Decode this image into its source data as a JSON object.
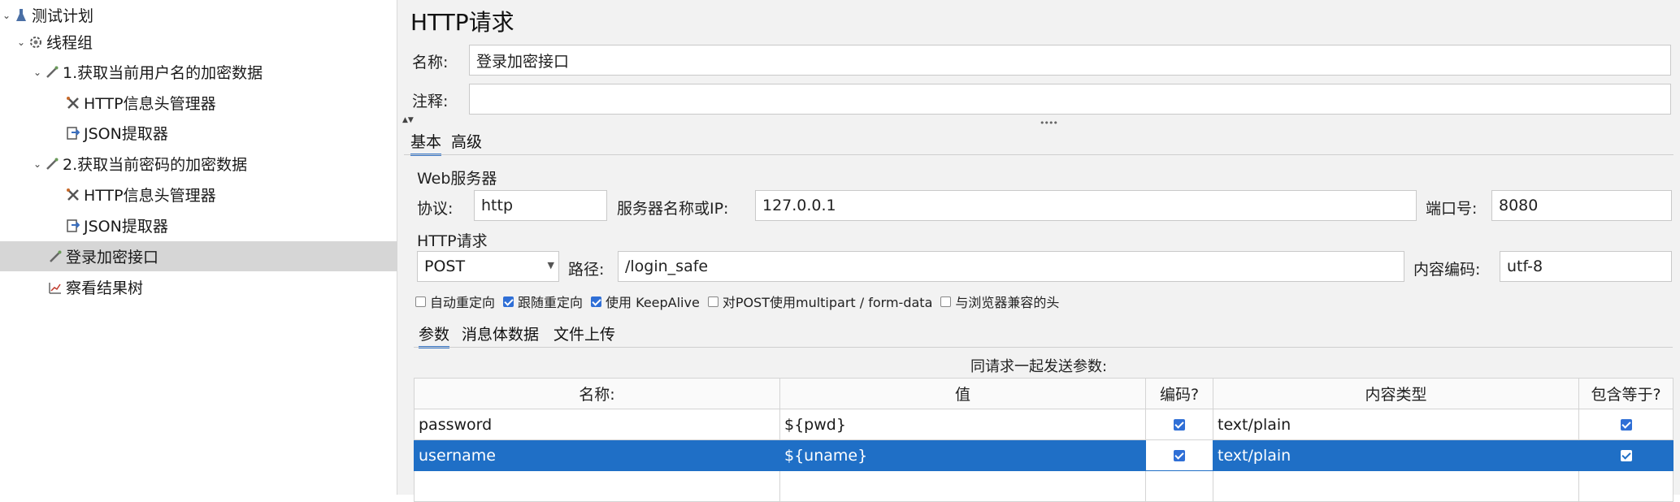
{
  "tree": {
    "items": [
      {
        "label": "测试计划",
        "icon": "test-plan-icon"
      },
      {
        "label": "线程组",
        "icon": "gear-icon"
      },
      {
        "label": "1.获取当前用户名的加密数据",
        "icon": "pipette-icon"
      },
      {
        "label": "HTTP信息头管理器",
        "icon": "tools-icon"
      },
      {
        "label": "JSON提取器",
        "icon": "extractor-icon"
      },
      {
        "label": "2.获取当前密码的加密数据",
        "icon": "pipette-icon"
      },
      {
        "label": "HTTP信息头管理器",
        "icon": "tools-icon"
      },
      {
        "label": "JSON提取器",
        "icon": "extractor-icon"
      },
      {
        "label": "登录加密接口",
        "icon": "pipette-icon"
      },
      {
        "label": "察看结果树",
        "icon": "chart-icon"
      }
    ]
  },
  "panel": {
    "title": "HTTP请求",
    "name_label": "名称:",
    "name_value": "登录加密接口",
    "comment_label": "注释:",
    "comment_value": "",
    "tabs": [
      "基本",
      "高级"
    ],
    "web_server": {
      "title": "Web服务器",
      "protocol_label": "协议:",
      "protocol_value": "http",
      "server_label": "服务器名称或IP:",
      "server_value": "127.0.0.1",
      "port_label": "端口号:",
      "port_value": "8080"
    },
    "http_request": {
      "title": "HTTP请求",
      "method": "POST",
      "path_label": "路径:",
      "path_value": "/login_safe",
      "encoding_label": "内容编码:",
      "encoding_value": "utf-8"
    },
    "options": [
      {
        "label": "自动重定向",
        "checked": false
      },
      {
        "label": "跟随重定向",
        "checked": true
      },
      {
        "label": "使用 KeepAlive",
        "checked": true
      },
      {
        "label": "对POST使用multipart / form-data",
        "checked": false
      },
      {
        "label": "与浏览器兼容的头",
        "checked": false
      }
    ],
    "sub_tabs": [
      "参数",
      "消息体数据",
      "文件上传"
    ],
    "params_caption": "同请求一起发送参数:",
    "params_headers": [
      "名称:",
      "值",
      "编码?",
      "内容类型",
      "包含等于?"
    ],
    "params_rows": [
      {
        "name": "password",
        "value": "${pwd}",
        "encode": true,
        "content_type": "text/plain",
        "include_equals": true
      },
      {
        "name": "username",
        "value": "${uname}",
        "encode": true,
        "content_type": "text/plain",
        "include_equals": true
      }
    ]
  }
}
